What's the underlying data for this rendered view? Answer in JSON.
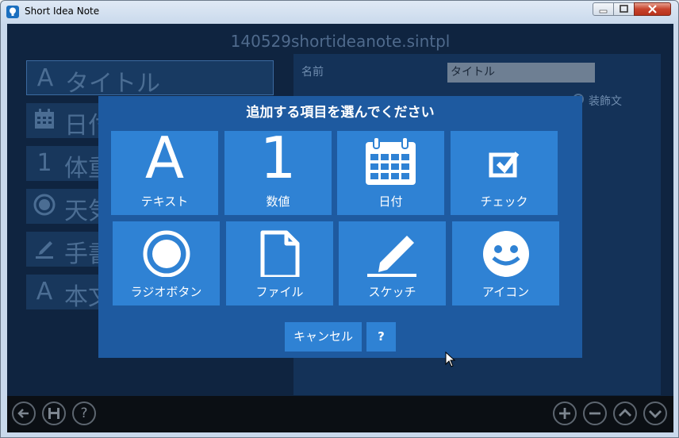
{
  "window": {
    "title": "Short Idea Note"
  },
  "file": {
    "name": "140529shortideanote.sintpl"
  },
  "left_list": {
    "items": [
      {
        "icon": "A",
        "icon_name": "text-icon",
        "label": "タイトル"
      },
      {
        "icon": "",
        "icon_name": "calendar-icon",
        "label": "日付"
      },
      {
        "icon": "1",
        "icon_name": "number-icon",
        "label": "体重"
      },
      {
        "icon": "",
        "icon_name": "radio-icon",
        "label": "天気"
      },
      {
        "icon": "",
        "icon_name": "pencil-icon",
        "label": "手書"
      },
      {
        "icon": "A",
        "icon_name": "text-icon",
        "label": "本文"
      }
    ]
  },
  "right_panel": {
    "name_label": "名前",
    "name_value": "タイトル",
    "radio_label": "装飾文"
  },
  "dialog": {
    "title": "追加する項目を選んでください",
    "tiles": [
      {
        "label": "テキスト",
        "icon": "text-icon",
        "glyph": "A"
      },
      {
        "label": "数値",
        "icon": "number-icon",
        "glyph": "1"
      },
      {
        "label": "日付",
        "icon": "calendar-icon"
      },
      {
        "label": "チェック",
        "icon": "checkbox-icon"
      },
      {
        "label": "ラジオボタン",
        "icon": "radio-icon"
      },
      {
        "label": "ファイル",
        "icon": "file-icon"
      },
      {
        "label": "スケッチ",
        "icon": "pencil-icon"
      },
      {
        "label": "アイコン",
        "icon": "smiley-icon"
      }
    ],
    "cancel_label": "キャンセル",
    "help_label": "?"
  },
  "bottom_bar": {
    "back": "←",
    "help": "?",
    "add": "+",
    "remove": "−",
    "up": "^",
    "down": "v"
  },
  "colors": {
    "background": "#0f2440",
    "dialog": "#1e5aa0",
    "tile": "#2f82d4"
  }
}
